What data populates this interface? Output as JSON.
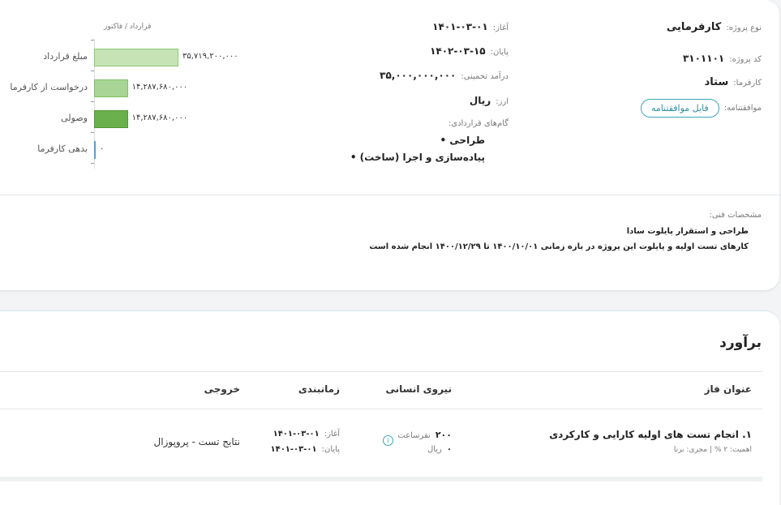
{
  "project": {
    "type_label": "نوع پروژه:",
    "type_value": "کارفرمایی",
    "code_label": "کد پروژه:",
    "code_value": "۳۱۰۱۱۰۱",
    "employer_label": "کارفرما:",
    "employer_value": "ستاد",
    "agreement_label": "موافقتنامه:",
    "agreement_button": "فایل موافقتنامه",
    "start_label": "آغاز:",
    "start_value": "۱۴۰۱-۰۳-۰۱",
    "end_label": "پایان:",
    "end_value": "۱۴۰۲-۰۳-۱۵",
    "revenue_label": "درآمد تخمینی:",
    "revenue_value": "۳۵,۰۰۰,۰۰۰,۰۰۰",
    "currency_label": "ارز:",
    "currency_value": "ریال",
    "milestones_label": "گام‌های قراردادی:",
    "milestones": [
      "طراحی",
      "پیاده‌سازی و اجرا (ساخت)"
    ]
  },
  "chart_data": {
    "type": "bar",
    "orientation": "horizontal",
    "title": "قرارداد / فاکتور",
    "categories": [
      "مبلغ قرارداد",
      "درخواست از کارفرما",
      "وصولی",
      "بدهی کارفرما"
    ],
    "values": [
      35719200000,
      14287680000,
      14287680000,
      0
    ],
    "value_labels": [
      "۳۵,۷۱۹,۲۰۰,۰۰۰",
      "۱۴,۲۸۷,۶۸۰,۰۰۰",
      "۱۴,۲۸۷,۶۸۰,۰۰۰",
      "۰"
    ],
    "colors": [
      "#c5e3b5",
      "#a8d595",
      "#6ab04c",
      "#5b9bd5"
    ],
    "border_colors": [
      "#8cc874",
      "#80c068",
      "#4e9a35",
      "#5b9bd5"
    ]
  },
  "technical": {
    "label": "مشخصات فنی:",
    "line1": "طراحی و استقرار پایلوت سادا",
    "line2": "کارهای تست اولیه و پایلوت این پروژه در بازه زمانی ۱۴۰۰/۱۰/۰۱ تا ۱۴۰۰/۱۲/۲۹ انجام شده است"
  },
  "estimate": {
    "title": "برآورد",
    "headers": {
      "phase": "عنوان فاز",
      "manpower": "نیروی انسانی",
      "schedule": "زمانبندی",
      "output": "خروجی"
    },
    "rows": [
      {
        "title": "۱. انجام تست های اولیه کارایی و کارکردی",
        "meta": "اهمیت: ۲ % | مجری: برنا",
        "hours_value": "۲۰۰",
        "hours_unit": "نفرساعت",
        "cost_value": "۰",
        "cost_unit": "ریال",
        "start_label": "آغاز:",
        "start_value": "۱۴۰۱-۰۳-۰۱",
        "end_label": "پایان:",
        "end_value": "۱۴۰۱-۰۳-۰۱",
        "output": "نتایج تست - پروپوزال"
      }
    ]
  },
  "colors": {
    "accent": "#3aa6b9"
  }
}
